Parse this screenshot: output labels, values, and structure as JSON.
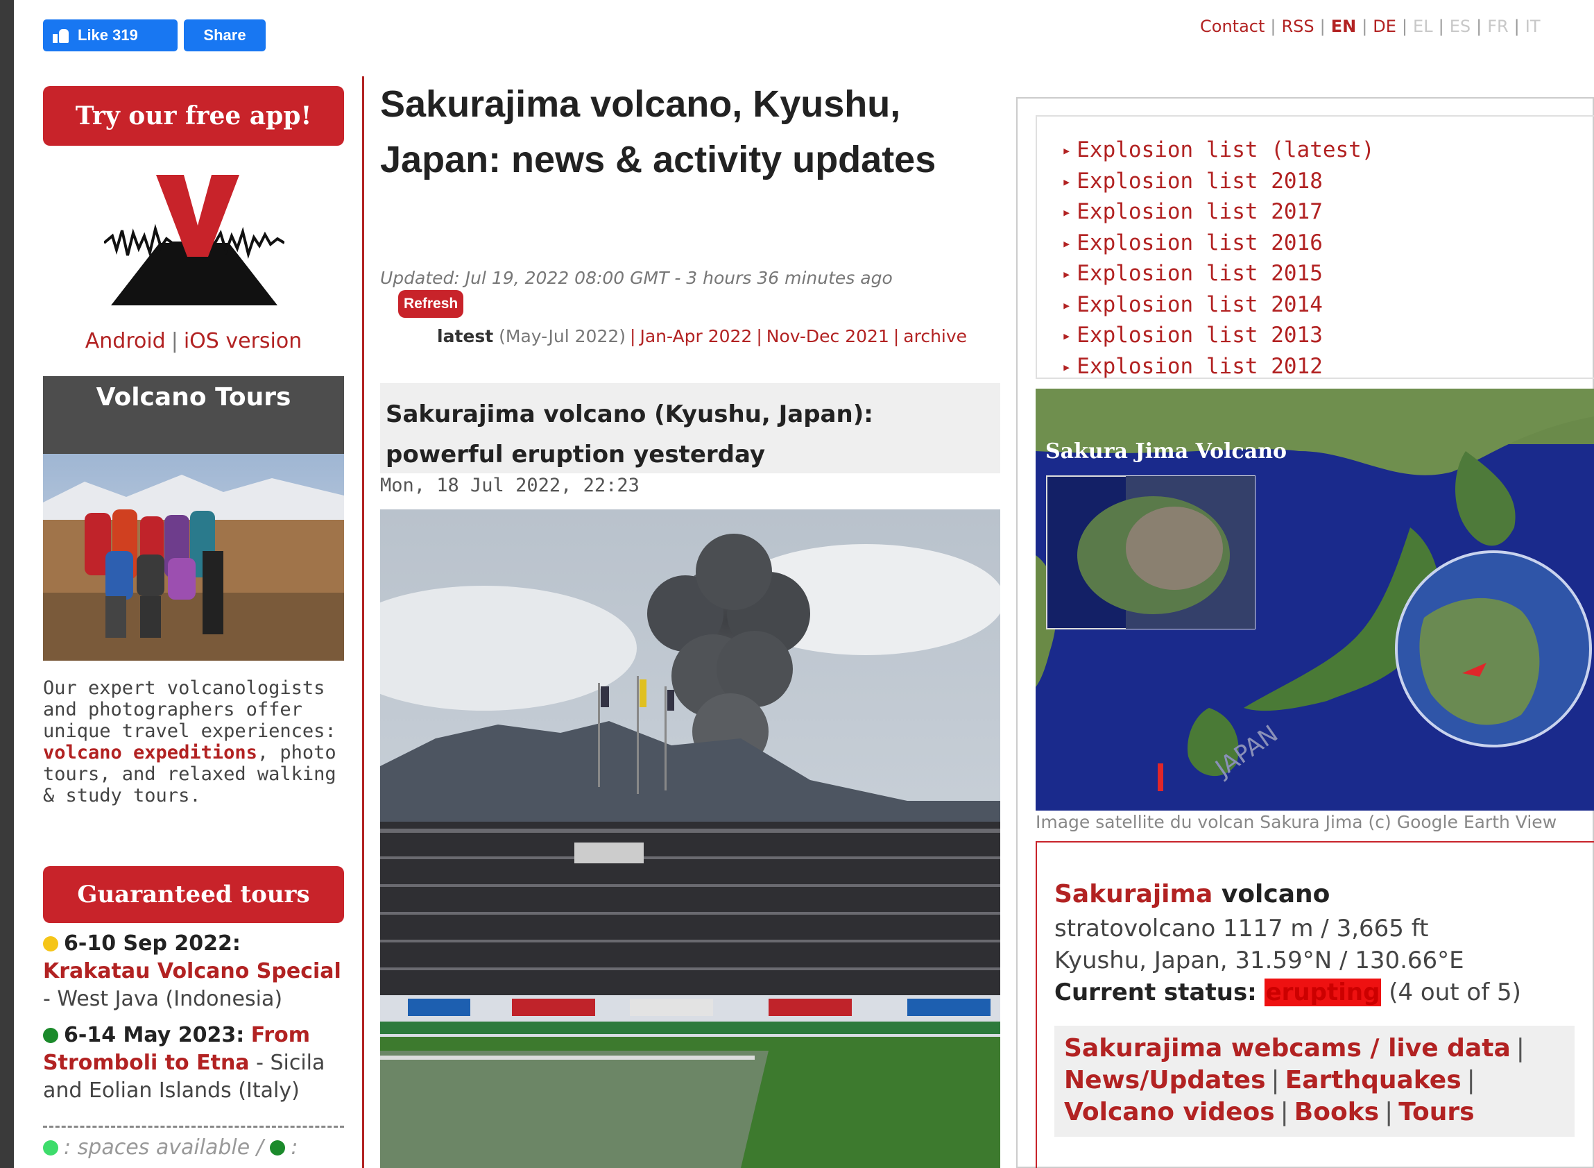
{
  "social": {
    "like_label": "Like 319",
    "share_label": "Share"
  },
  "top_links": {
    "contact": "Contact",
    "rss": "RSS",
    "en": "EN",
    "de": "DE",
    "el": "EL",
    "es": "ES",
    "fr": "FR",
    "it": "IT"
  },
  "sidebar": {
    "app_button": "Try our free app!",
    "android": "Android",
    "ios": "iOS version",
    "tours_heading": "Volcano Tours",
    "tours_desc_start": "Our expert volcanologists and photographers offer unique travel experiences: ",
    "tours_desc_link": "volcano expeditions",
    "tours_desc_end": ", photo tours, and relaxed walking & study tours.",
    "guaranteed_button": "Guaranteed tours",
    "tours": [
      {
        "date": "6-10 Sep 2022:",
        "name": "Krakatau Volcano Special",
        "place": " - West Java (Indonesia)",
        "status_color": "#f5c518"
      },
      {
        "date": "6-14 May 2023:",
        "name": "From Stromboli to Etna",
        "place": " - Sicila and Eolian Islands (Italy)",
        "status_color": "#1b8a2b"
      }
    ],
    "legend_available": ": spaces available / ",
    "legend_colon": ":"
  },
  "main": {
    "title": "Sakurajima volcano, Kyushu, Japan: news & activity updates",
    "updated": "Updated: Jul 19, 2022 08:00 GMT - 3 hours 36 minutes ago",
    "refresh": "Refresh",
    "archive": {
      "latest": "latest",
      "latest_range": " (May-Jul 2022)",
      "janapr": "Jan-Apr 2022",
      "novdec": "Nov-Dec 2021",
      "archive": "archive"
    },
    "article_title": "Sakurajima volcano (Kyushu, Japan): powerful eruption yesterday",
    "article_date": "Mon, 18 Jul 2022, 22:23"
  },
  "right": {
    "explosion_lists": [
      "Explosion list (latest)",
      "Explosion list 2018",
      "Explosion list 2017",
      "Explosion list 2016",
      "Explosion list 2015",
      "Explosion list 2014",
      "Explosion list 2013",
      "Explosion list 2012"
    ],
    "map_label": "Sakura Jima Volcano",
    "map_country": "JAPAN",
    "map_caption": "Image satellite du volcan Sakura Jima (c) Google Earth View",
    "info": {
      "name": "Sakurajima",
      "name_suffix": " volcano",
      "type": "stratovolcano 1117 m / 3,665 ft",
      "location": "Kyushu, Japan, 31.59°N / 130.66°E",
      "status_label": "Current status:",
      "status_value": "erupting",
      "status_scale": " (4 out of 5)"
    },
    "links": {
      "webcams": "Sakurajima webcams / live data",
      "news": "News/Updates",
      "quakes": "Earthquakes",
      "videos": "Volcano videos",
      "books": "Books",
      "tours": "Tours"
    }
  },
  "colors": {
    "accent": "#b22222",
    "button_red": "#c8232a",
    "facebook": "#1877f2",
    "erupting": "#ee1111"
  }
}
